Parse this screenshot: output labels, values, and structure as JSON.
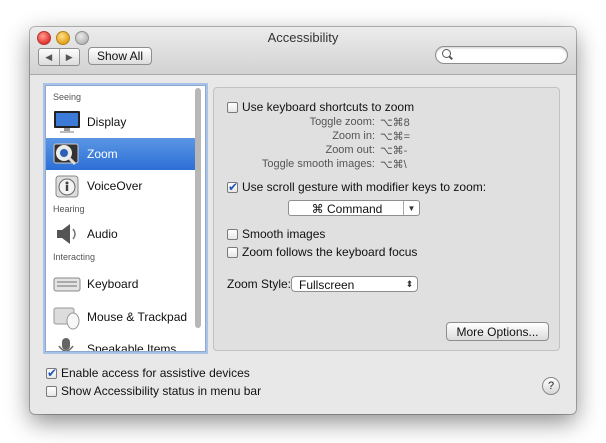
{
  "window": {
    "title": "Accessibility",
    "nav_back": "◀",
    "nav_forward": "▶",
    "show_all": "Show All",
    "search_placeholder": ""
  },
  "sidebar": {
    "groups": [
      "Seeing",
      "Hearing",
      "Interacting"
    ],
    "items": [
      {
        "label": "Display",
        "icon": "display-icon"
      },
      {
        "label": "Zoom",
        "icon": "zoom-icon",
        "selected": true
      },
      {
        "label": "VoiceOver",
        "icon": "voiceover-icon"
      },
      {
        "label": "Audio",
        "icon": "audio-icon"
      },
      {
        "label": "Keyboard",
        "icon": "keyboard-icon"
      },
      {
        "label": "Mouse & Trackpad",
        "icon": "mouse-trackpad-icon"
      },
      {
        "label": "Speakable Items",
        "icon": "speakable-items-icon"
      }
    ]
  },
  "zoom": {
    "keyboard_shortcuts": {
      "label": "Use keyboard shortcuts to zoom",
      "checked": false
    },
    "shortcuts": [
      {
        "label": "Toggle zoom:",
        "keys": "⌥⌘8"
      },
      {
        "label": "Zoom in:",
        "keys": "⌥⌘="
      },
      {
        "label": "Zoom out:",
        "keys": "⌥⌘-"
      },
      {
        "label": "Toggle smooth images:",
        "keys": "⌥⌘\\"
      }
    ],
    "scroll_gesture": {
      "label": "Use scroll gesture with modifier keys to zoom:",
      "checked": true
    },
    "modifier_key": "⌘ Command",
    "smooth_images": {
      "label": "Smooth images",
      "checked": false
    },
    "follow_focus": {
      "label": "Zoom follows the keyboard focus",
      "checked": false
    },
    "zoom_style_label": "Zoom Style:",
    "zoom_style_value": "Fullscreen",
    "more_options": "More Options..."
  },
  "footer": {
    "assistive_devices": {
      "label": "Enable access for assistive devices",
      "checked": true
    },
    "menu_bar_status": {
      "label": "Show Accessibility status in menu bar",
      "checked": false
    },
    "help": "?"
  }
}
